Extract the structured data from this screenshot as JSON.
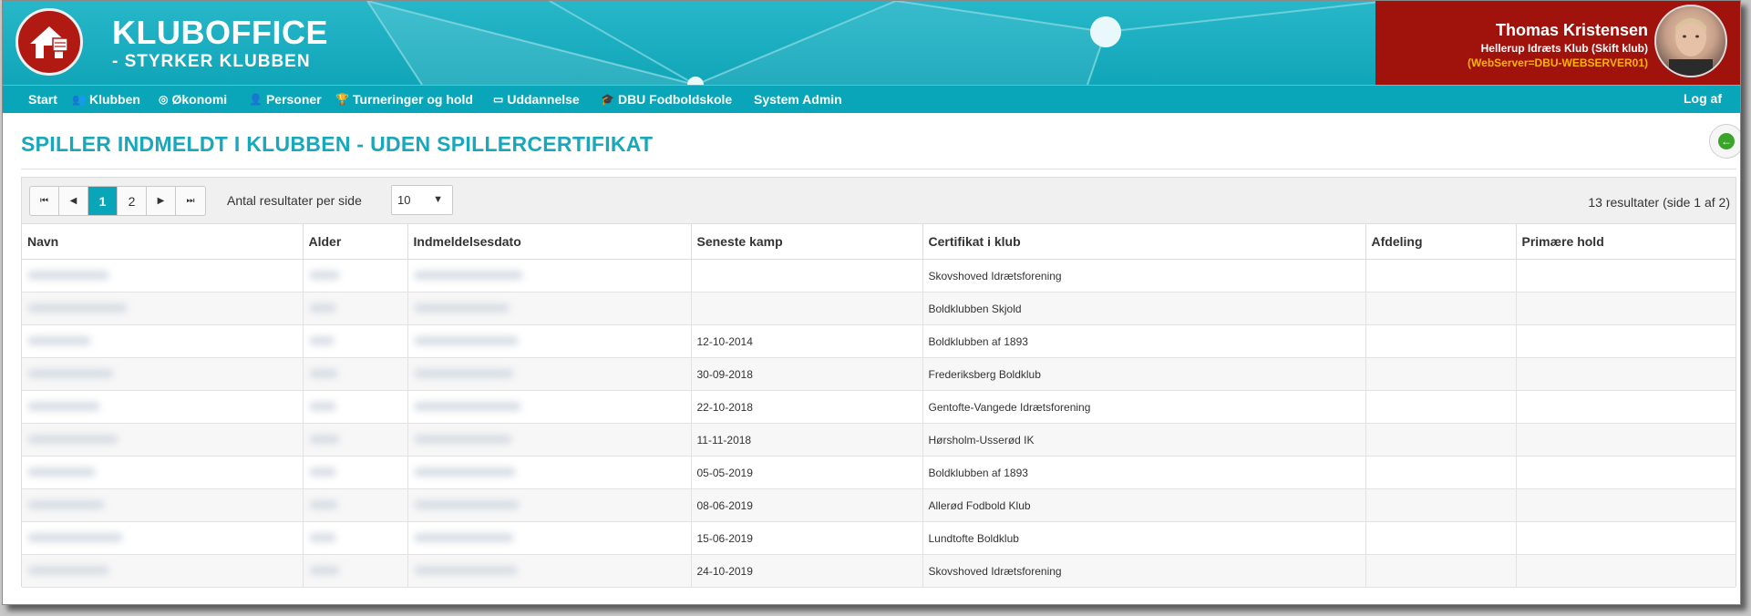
{
  "header": {
    "brand_title": "KLUBOFFICE",
    "brand_subtitle": "- STYRKER KLUBBEN",
    "user_name": "Thomas Kristensen",
    "user_club": "Hellerup Idræts Klub (Skift klub)",
    "server_info": "(WebServer=DBU-WEBSERVER01)",
    "accent_color": "#09a6ba",
    "user_panel_color": "#a0120c"
  },
  "nav": {
    "items": [
      {
        "label": "Start",
        "icon": ""
      },
      {
        "label": "Klubben",
        "icon": "people-icon"
      },
      {
        "label": "Økonomi",
        "icon": "coin-icon"
      },
      {
        "label": "Personer",
        "icon": "person-icon"
      },
      {
        "label": "Turneringer og hold",
        "icon": "trophy-icon"
      },
      {
        "label": "Uddannelse",
        "icon": "presentation-icon"
      },
      {
        "label": "DBU Fodboldskole",
        "icon": "graduation-cap-icon"
      },
      {
        "label": "System Admin",
        "icon": ""
      }
    ],
    "logoff": "Log af"
  },
  "page": {
    "title": "SPILLER INDMELDT I KLUBBEN - UDEN SPILLERCERTIFIKAT"
  },
  "grid": {
    "pager": {
      "pages": [
        "1",
        "2"
      ],
      "active": "1"
    },
    "per_page_label": "Antal resultater per side",
    "per_page_value": "10",
    "result_info": "13 resultater (side 1 af 2)",
    "columns": [
      "Navn",
      "Alder",
      "Indmeldelsesdato",
      "Seneste kamp",
      "Certifikat i klub",
      "Afdeling",
      "Primære hold"
    ],
    "rows": [
      {
        "seneste_kamp": "",
        "certifikat": "Skovshoved Idrætsforening"
      },
      {
        "seneste_kamp": "",
        "certifikat": "Boldklubben Skjold"
      },
      {
        "seneste_kamp": "12-10-2014",
        "certifikat": "Boldklubben af 1893"
      },
      {
        "seneste_kamp": "30-09-2018",
        "certifikat": "Frederiksberg Boldklub"
      },
      {
        "seneste_kamp": "22-10-2018",
        "certifikat": "Gentofte-Vangede Idrætsforening"
      },
      {
        "seneste_kamp": "11-11-2018",
        "certifikat": "Hørsholm-Usserød IK"
      },
      {
        "seneste_kamp": "05-05-2019",
        "certifikat": "Boldklubben af 1893"
      },
      {
        "seneste_kamp": "08-06-2019",
        "certifikat": "Allerød Fodbold Klub"
      },
      {
        "seneste_kamp": "15-06-2019",
        "certifikat": "Lundtofte Boldklub"
      },
      {
        "seneste_kamp": "24-10-2019",
        "certifikat": "Skovshoved Idrætsforening"
      }
    ]
  }
}
